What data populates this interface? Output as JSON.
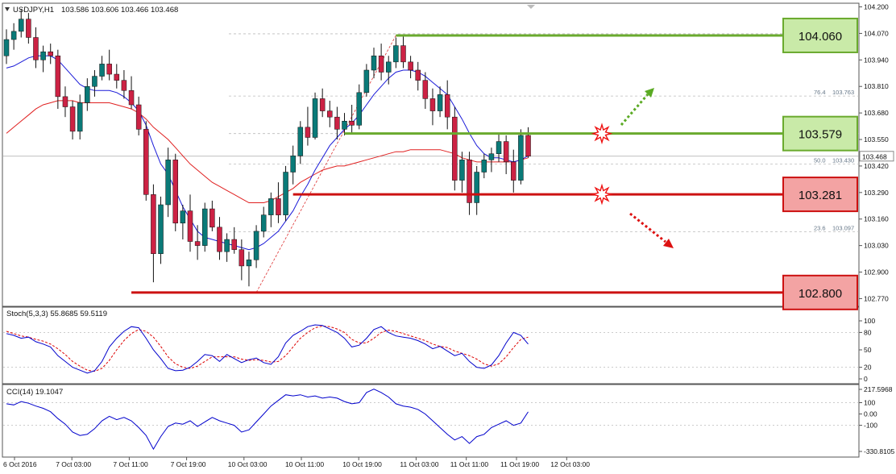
{
  "window": {
    "symbol_label": "USDJPY,H1",
    "ohlc": "103.586 103.606 103.466 103.468",
    "menu_arrow_icon": "triangle-down-icon"
  },
  "price_axis": {
    "ticks": [
      "104.200",
      "104.070",
      "103.940",
      "103.810",
      "103.680",
      "103.550",
      "103.420",
      "103.290",
      "103.160",
      "103.030",
      "102.900",
      "102.770"
    ],
    "current_price": "103.468",
    "range": [
      102.74,
      104.21
    ]
  },
  "time_axis": {
    "labels": [
      "6 Oct 2016",
      "7 Oct 03:00",
      "7 Oct 11:00",
      "7 Oct 19:00",
      "10 Oct 03:00",
      "10 Oct 11:00",
      "10 Oct 19:00",
      "11 Oct 03:00",
      "11 Oct 11:00",
      "11 Oct 19:00",
      "12 Oct 03:00"
    ]
  },
  "levels": [
    {
      "label": "104.060",
      "price": 104.06,
      "kind": "resistance",
      "color": "#6aaa2e",
      "fill": "#c9eaa8"
    },
    {
      "label": "103.579",
      "price": 103.579,
      "kind": "resistance",
      "color": "#6aaa2e",
      "fill": "#c9eaa8"
    },
    {
      "label": "103.281",
      "price": 103.281,
      "kind": "support",
      "color": "#cc1111",
      "fill": "#f3a3a3"
    },
    {
      "label": "102.800",
      "price": 102.8,
      "kind": "support",
      "color": "#cc1111",
      "fill": "#f3a3a3"
    }
  ],
  "fibonacci": [
    {
      "ratio": "76.4",
      "price": "103.763"
    },
    {
      "ratio": "50.0",
      "price": "103.430"
    },
    {
      "ratio": "23.6",
      "price": "103.097"
    }
  ],
  "signals": {
    "up_arrow_icon": "dotted-arrow-up-icon",
    "down_arrow_icon": "dotted-arrow-down-icon",
    "breakout_icon": "starburst-icon",
    "up_color": "#5aaa23",
    "down_color": "#dd1111"
  },
  "stochastic": {
    "label": "Stoch(5,3,3) 55.8685 59.5119",
    "ticks": [
      "100",
      "80",
      "50",
      "20",
      "0"
    ],
    "main_color": "#0000cc",
    "signal_color": "#dd0000"
  },
  "cci": {
    "label": "CCI(14) 19.1047",
    "ticks": [
      "217.5968",
      "100",
      "0.00",
      "-100",
      "-330.8105"
    ],
    "color": "#0000cc"
  },
  "colors": {
    "bull_candle": "#0a7a78",
    "bear_candle": "#cc2244",
    "ma_fast": "#1a1ad8",
    "ma_slow": "#e02020",
    "grid": "#bbbbbb"
  },
  "chart_data": {
    "type": "candlestick",
    "symbol": "USDJPY",
    "timeframe": "H1",
    "candles": [
      [
        103.96,
        104.09,
        103.92,
        104.04
      ],
      [
        104.04,
        104.12,
        103.99,
        104.08
      ],
      [
        104.08,
        104.19,
        104.05,
        104.14
      ],
      [
        104.14,
        104.17,
        104.02,
        104.05
      ],
      [
        104.05,
        104.1,
        103.9,
        103.94
      ],
      [
        103.94,
        104.01,
        103.88,
        103.98
      ],
      [
        103.98,
        104.02,
        103.92,
        103.96
      ],
      [
        103.96,
        103.99,
        103.7,
        103.76
      ],
      [
        103.76,
        103.81,
        103.66,
        103.71
      ],
      [
        103.71,
        103.74,
        103.55,
        103.59
      ],
      [
        103.59,
        103.77,
        103.55,
        103.73
      ],
      [
        103.73,
        103.85,
        103.69,
        103.81
      ],
      [
        103.81,
        103.89,
        103.76,
        103.86
      ],
      [
        103.86,
        103.96,
        103.84,
        103.92
      ],
      [
        103.92,
        103.99,
        103.84,
        103.87
      ],
      [
        103.87,
        103.92,
        103.8,
        103.84
      ],
      [
        103.84,
        103.89,
        103.75,
        103.79
      ],
      [
        103.79,
        103.86,
        103.7,
        103.72
      ],
      [
        103.72,
        103.76,
        103.57,
        103.6
      ],
      [
        103.6,
        103.64,
        103.25,
        103.28
      ],
      [
        103.28,
        103.33,
        102.85,
        102.99
      ],
      [
        102.99,
        103.27,
        102.94,
        103.23
      ],
      [
        103.23,
        103.51,
        103.17,
        103.45
      ],
      [
        103.45,
        103.48,
        103.1,
        103.14
      ],
      [
        103.14,
        103.23,
        103.06,
        103.2
      ],
      [
        103.2,
        103.28,
        103.0,
        103.05
      ],
      [
        103.05,
        103.13,
        102.96,
        103.03
      ],
      [
        103.03,
        103.24,
        103.0,
        103.21
      ],
      [
        103.21,
        103.25,
        103.1,
        103.12
      ],
      [
        103.12,
        103.17,
        102.96,
        103.0
      ],
      [
        103.0,
        103.09,
        102.95,
        103.06
      ],
      [
        103.06,
        103.12,
        102.99,
        103.01
      ],
      [
        103.01,
        103.06,
        102.86,
        102.93
      ],
      [
        102.93,
        103.0,
        102.83,
        102.96
      ],
      [
        102.96,
        103.13,
        102.92,
        103.1
      ],
      [
        103.1,
        103.22,
        103.07,
        103.18
      ],
      [
        103.18,
        103.29,
        103.12,
        103.26
      ],
      [
        103.26,
        103.34,
        103.14,
        103.18
      ],
      [
        103.18,
        103.42,
        103.15,
        103.39
      ],
      [
        103.39,
        103.52,
        103.33,
        103.47
      ],
      [
        103.47,
        103.64,
        103.43,
        103.61
      ],
      [
        103.61,
        103.71,
        103.52,
        103.56
      ],
      [
        103.56,
        103.78,
        103.55,
        103.75
      ],
      [
        103.75,
        103.8,
        103.66,
        103.69
      ],
      [
        103.69,
        103.74,
        103.61,
        103.66
      ],
      [
        103.66,
        103.71,
        103.55,
        103.6
      ],
      [
        103.6,
        103.68,
        103.57,
        103.64
      ],
      [
        103.64,
        103.72,
        103.58,
        103.62
      ],
      [
        103.62,
        103.82,
        103.6,
        103.78
      ],
      [
        103.78,
        103.92,
        103.76,
        103.89
      ],
      [
        103.89,
        104.0,
        103.85,
        103.96
      ],
      [
        103.96,
        104.02,
        103.84,
        103.88
      ],
      [
        103.88,
        103.96,
        103.82,
        103.93
      ],
      [
        103.93,
        104.05,
        103.9,
        104.01
      ],
      [
        104.01,
        104.06,
        103.9,
        103.93
      ],
      [
        103.93,
        103.96,
        103.85,
        103.89
      ],
      [
        103.89,
        103.93,
        103.79,
        103.84
      ],
      [
        103.84,
        103.88,
        103.7,
        103.75
      ],
      [
        103.75,
        103.8,
        103.62,
        103.69
      ],
      [
        103.69,
        103.81,
        103.66,
        103.77
      ],
      [
        103.77,
        103.84,
        103.6,
        103.66
      ],
      [
        103.66,
        103.71,
        103.3,
        103.35
      ],
      [
        103.35,
        103.49,
        103.29,
        103.45
      ],
      [
        103.45,
        103.49,
        103.18,
        103.24
      ],
      [
        103.24,
        103.42,
        103.18,
        103.39
      ],
      [
        103.39,
        103.48,
        103.36,
        103.45
      ],
      [
        103.45,
        103.51,
        103.39,
        103.48
      ],
      [
        103.48,
        103.58,
        103.44,
        103.54
      ],
      [
        103.54,
        103.57,
        103.38,
        103.44
      ],
      [
        103.44,
        103.5,
        103.29,
        103.35
      ],
      [
        103.35,
        103.6,
        103.33,
        103.57
      ],
      [
        103.57,
        103.61,
        103.46,
        103.468
      ]
    ],
    "ma_fast": [
      103.9,
      103.91,
      103.93,
      103.95,
      103.96,
      103.96,
      103.96,
      103.94,
      103.9,
      103.86,
      103.82,
      103.8,
      103.79,
      103.79,
      103.79,
      103.78,
      103.76,
      103.73,
      103.69,
      103.62,
      103.52,
      103.43,
      103.38,
      103.3,
      103.22,
      103.16,
      103.1,
      103.07,
      103.06,
      103.05,
      103.04,
      103.03,
      103.02,
      103.01,
      103.02,
      103.04,
      103.07,
      103.1,
      103.15,
      103.2,
      103.27,
      103.33,
      103.4,
      103.46,
      103.52,
      103.56,
      103.6,
      103.63,
      103.67,
      103.72,
      103.77,
      103.81,
      103.85,
      103.88,
      103.89,
      103.89,
      103.88,
      103.86,
      103.83,
      103.8,
      103.77,
      103.71,
      103.65,
      103.58,
      103.52,
      103.48,
      103.46,
      103.46,
      103.45,
      103.44,
      103.45,
      103.47
    ],
    "ma_slow": [
      103.58,
      103.61,
      103.64,
      103.67,
      103.7,
      103.72,
      103.73,
      103.74,
      103.74,
      103.74,
      103.73,
      103.73,
      103.73,
      103.73,
      103.73,
      103.72,
      103.71,
      103.7,
      103.68,
      103.65,
      103.61,
      103.58,
      103.55,
      103.51,
      103.47,
      103.43,
      103.4,
      103.37,
      103.34,
      103.32,
      103.3,
      103.28,
      103.26,
      103.24,
      103.24,
      103.24,
      103.25,
      103.27,
      103.29,
      103.31,
      103.34,
      103.36,
      103.38,
      103.4,
      103.41,
      103.42,
      103.42,
      103.43,
      103.44,
      103.45,
      103.46,
      103.47,
      103.48,
      103.49,
      103.49,
      103.5,
      103.5,
      103.5,
      103.5,
      103.5,
      103.49,
      103.48,
      103.46,
      103.45,
      103.44,
      103.44,
      103.44,
      103.44,
      103.44,
      103.44,
      103.45,
      103.46
    ],
    "stoch_main": [
      78,
      75,
      70,
      72,
      64,
      60,
      55,
      40,
      30,
      20,
      15,
      10,
      14,
      30,
      55,
      70,
      82,
      90,
      88,
      70,
      50,
      35,
      18,
      14,
      15,
      20,
      30,
      42,
      40,
      30,
      42,
      35,
      28,
      33,
      36,
      28,
      25,
      38,
      62,
      75,
      82,
      90,
      93,
      92,
      86,
      80,
      70,
      55,
      58,
      70,
      85,
      90,
      80,
      74,
      72,
      70,
      66,
      60,
      52,
      56,
      48,
      40,
      44,
      30,
      20,
      18,
      24,
      40,
      62,
      80,
      75,
      60
    ],
    "stoch_signal": [
      82,
      78,
      74,
      72,
      68,
      65,
      60,
      52,
      42,
      30,
      22,
      15,
      13,
      18,
      32,
      50,
      66,
      78,
      85,
      82,
      72,
      56,
      38,
      26,
      20,
      18,
      22,
      30,
      38,
      38,
      38,
      38,
      34,
      32,
      33,
      32,
      29,
      30,
      40,
      55,
      70,
      80,
      88,
      91,
      90,
      86,
      80,
      68,
      62,
      62,
      70,
      80,
      84,
      82,
      78,
      74,
      70,
      66,
      60,
      56,
      54,
      48,
      44,
      40,
      34,
      26,
      22,
      26,
      38,
      54,
      68,
      72
    ],
    "cci": [
      90,
      80,
      110,
      95,
      70,
      50,
      20,
      -40,
      -90,
      -160,
      -190,
      -180,
      -130,
      -60,
      -20,
      -50,
      -30,
      -60,
      -120,
      -190,
      -310,
      -200,
      -110,
      -80,
      -90,
      -60,
      -110,
      -70,
      -30,
      -60,
      -80,
      -100,
      -160,
      -140,
      -70,
      0,
      70,
      120,
      170,
      160,
      170,
      150,
      160,
      140,
      150,
      140,
      110,
      90,
      100,
      190,
      220,
      190,
      150,
      90,
      70,
      60,
      40,
      0,
      -60,
      -120,
      -180,
      -230,
      -200,
      -260,
      -200,
      -180,
      -120,
      -90,
      -60,
      -100,
      -80,
      19
    ]
  }
}
